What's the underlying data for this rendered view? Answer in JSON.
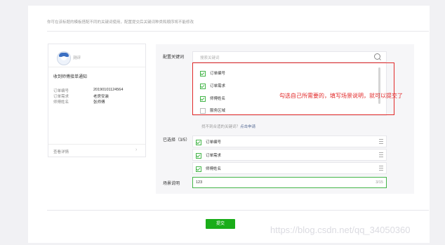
{
  "top_hint": "你可在该标题的模板搭配不同的关键词使用，配置提交后关键词种类和顺序将不能修改",
  "preview": {
    "account": "测评",
    "title": "收到师傅接单通知",
    "fields": [
      {
        "label": "订单编号",
        "value": "2019010112456​4"
      },
      {
        "label": "订单需求",
        "value": "老房安装"
      },
      {
        "label": "师傅姓名",
        "value": "张师傅"
      }
    ],
    "footer": "查看详情",
    "footer_arrow": "›"
  },
  "config": {
    "keyword_label": "配置关键词",
    "search_placeholder": "搜索关键词",
    "keywords": [
      {
        "label": "订单编号",
        "checked": true
      },
      {
        "label": "订单需求",
        "checked": true
      },
      {
        "label": "师傅姓名",
        "checked": true
      },
      {
        "label": "服务区域",
        "checked": false
      }
    ],
    "annotation": "勾选自己所需要的，填写场景说明，就可以提交了",
    "not_found": "找不到合适的关键词？",
    "apply_link": "点击申请",
    "selected_label": "已选择（3/5）",
    "selected": [
      "订单编号",
      "订单需求",
      "师傅姓名"
    ],
    "scene_label": "场景说明",
    "scene_value": "123",
    "scene_count": "3/15"
  },
  "submit_label": "提交",
  "watermark": "https://blog.csdn.net/qq_34050360"
}
